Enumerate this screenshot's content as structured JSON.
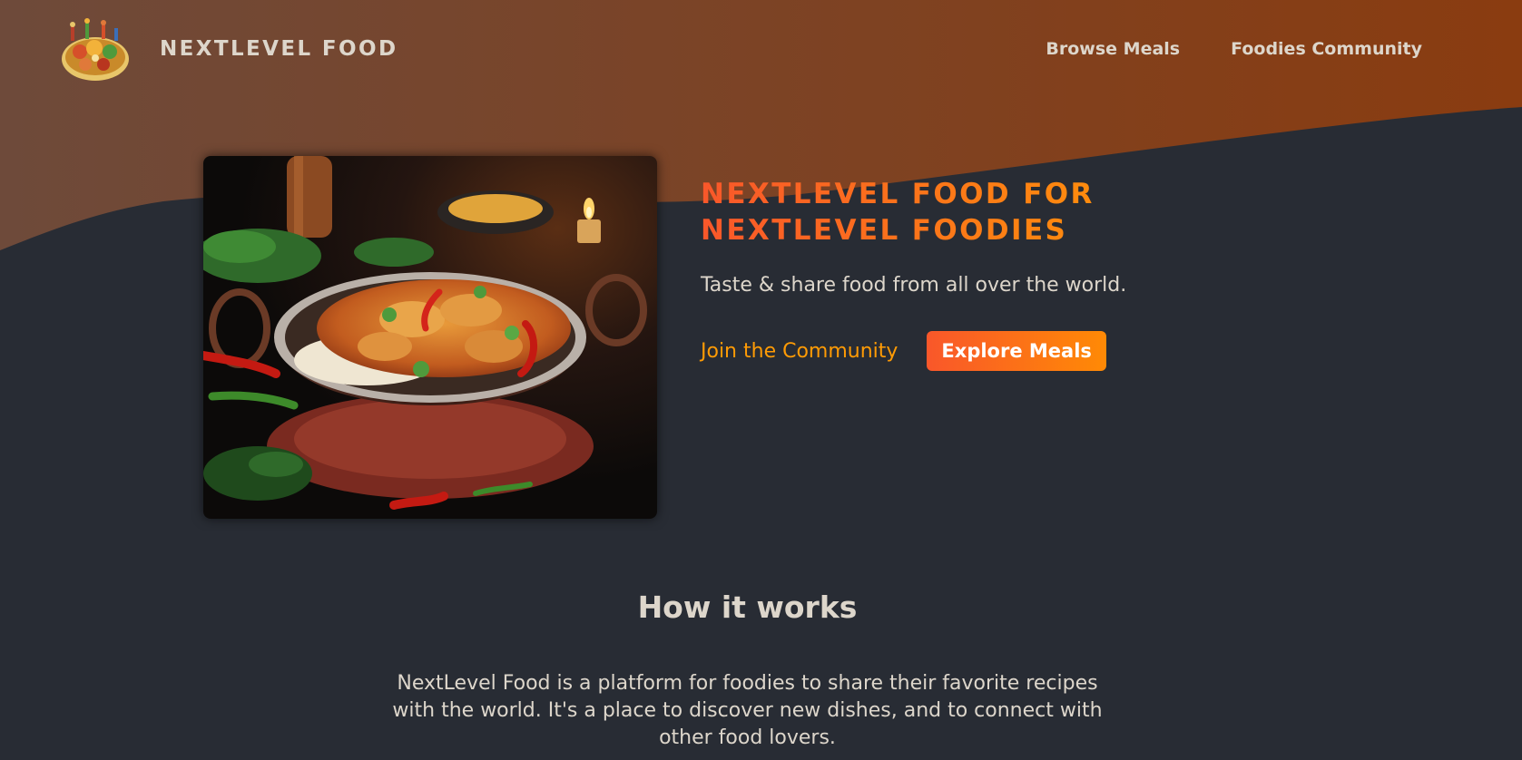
{
  "header": {
    "brand_text": "NEXTLEVEL FOOD",
    "nav": [
      {
        "label": "Browse Meals"
      },
      {
        "label": "Foodies Community"
      }
    ]
  },
  "hero": {
    "title_line1": "NEXTLEVEL FOOD FOR",
    "title_line2": "NEXTLEVEL FOODIES",
    "subtitle": "Taste & share food from all over the world.",
    "join_label": "Join the Community",
    "explore_label": "Explore Meals"
  },
  "how_it_works": {
    "title": "How it works",
    "text": "NextLevel Food is a platform for foodies to share their favorite recipes with the world. It's a place to discover new dishes, and to connect with other food lovers."
  },
  "colors": {
    "background": "#282c34",
    "wave_start": "#6e4a3a",
    "wave_end": "#8a3c10",
    "accent_start": "#f9572a",
    "accent_end": "#ff9b05",
    "text": "#ddd6cb"
  },
  "icons": {
    "logo": "food-platter-logo"
  }
}
